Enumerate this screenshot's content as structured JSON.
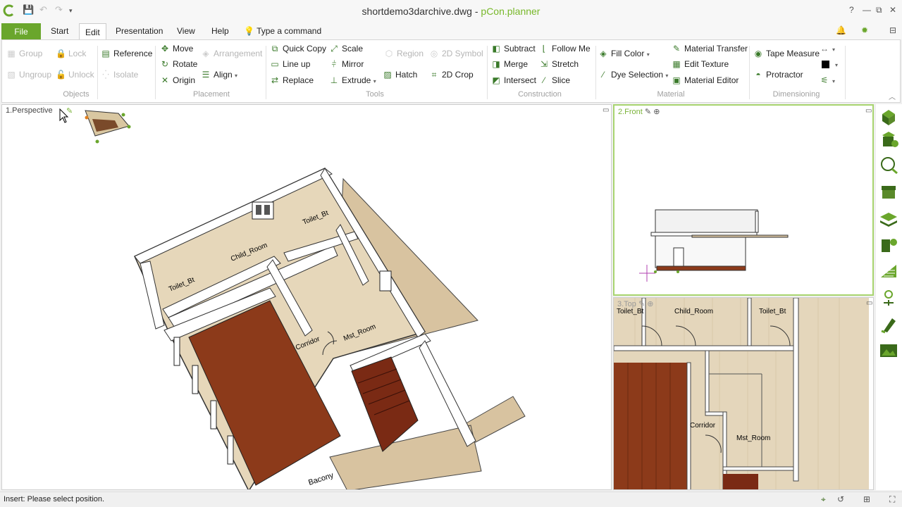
{
  "window": {
    "file_name": "shortdemo3darchive.dwg",
    "separator": " - ",
    "app_name": "pCon.planner",
    "help_label": "?",
    "minimize_label": "—",
    "restore_label": "⧉",
    "close_label": "✕"
  },
  "tabs": {
    "file": "File",
    "start": "Start",
    "edit": "Edit",
    "presentation": "Presentation",
    "view": "View",
    "help": "Help",
    "command_placeholder": "Type a command"
  },
  "ribbon": {
    "objects": {
      "group": "Group",
      "lock": "Lock",
      "ungroup": "Ungroup",
      "unlock": "Unlock",
      "reference": "Reference",
      "isolate": "Isolate",
      "label": "Objects"
    },
    "placement": {
      "move": "Move",
      "arrangement": "Arrangement",
      "rotate": "Rotate",
      "align": "Align",
      "origin": "Origin",
      "label": "Placement"
    },
    "tools": {
      "quick_copy": "Quick Copy",
      "scale": "Scale",
      "region": "Region",
      "symbol_2d": "2D Symbol",
      "line_up": "Line up",
      "mirror": "Mirror",
      "replace": "Replace",
      "extrude": "Extrude",
      "hatch": "Hatch",
      "crop_2d": "2D Crop",
      "label": "Tools"
    },
    "construction": {
      "subtract": "Subtract",
      "follow_me": "Follow Me",
      "merge": "Merge",
      "stretch": "Stretch",
      "intersect": "Intersect",
      "slice": "Slice",
      "label": "Construction"
    },
    "material": {
      "fill_color": "Fill Color",
      "dye_selection": "Dye Selection",
      "material_transfer": "Material Transfer",
      "edit_texture": "Edit Texture",
      "material_editor": "Material Editor",
      "label": "Material"
    },
    "dimensioning": {
      "tape_measure": "Tape Measure",
      "protractor": "Protractor",
      "label": "Dimensioning"
    }
  },
  "viewports": {
    "perspective": "1.Perspective",
    "front": "2.Front",
    "top": "3.Top"
  },
  "rooms": {
    "toilet_1": "Toilet_Bt",
    "child_room": "Child_Room",
    "toilet_2": "Toilet_Bt",
    "corridor": "Corridor",
    "mst_room": "Mst_Room",
    "bacony": "Bacony"
  },
  "status": {
    "message": "Insert: Please select position."
  },
  "colors": {
    "accent": "#6aa62c",
    "floor_wood": "#d8c3a0",
    "floor_dark": "#8c3a1a",
    "active_border": "#a8d46f"
  }
}
